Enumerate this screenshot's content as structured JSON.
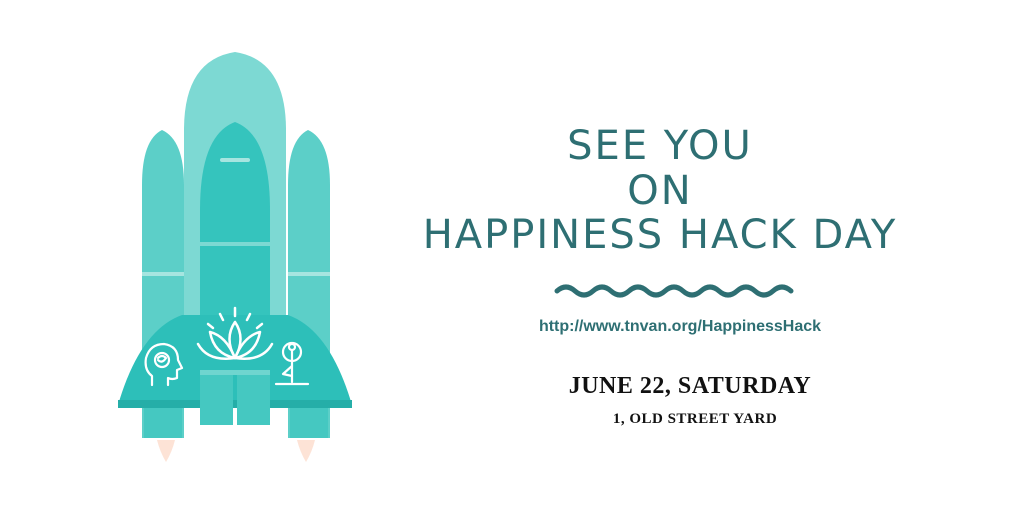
{
  "headline": {
    "line1": "SEE YOU",
    "line2": "ON",
    "line3": "HAPPINESS HACK DAY"
  },
  "link": {
    "url_text": "http://www.tnvan.org/HappinessHack"
  },
  "event": {
    "date": "JUNE 22, SATURDAY",
    "place": "1, OLD STREET YARD"
  },
  "colors": {
    "rocket_main": "#5ccfc8",
    "rocket_dark": "#2dbfb9",
    "rocket_light": "#7dd9d3",
    "text_accent": "#2e6f73",
    "flame": "#fde3d6"
  },
  "icons": [
    "rocket-illustration",
    "mind-head-icon",
    "lotus-icon",
    "yoga-pose-icon",
    "wave-divider"
  ]
}
